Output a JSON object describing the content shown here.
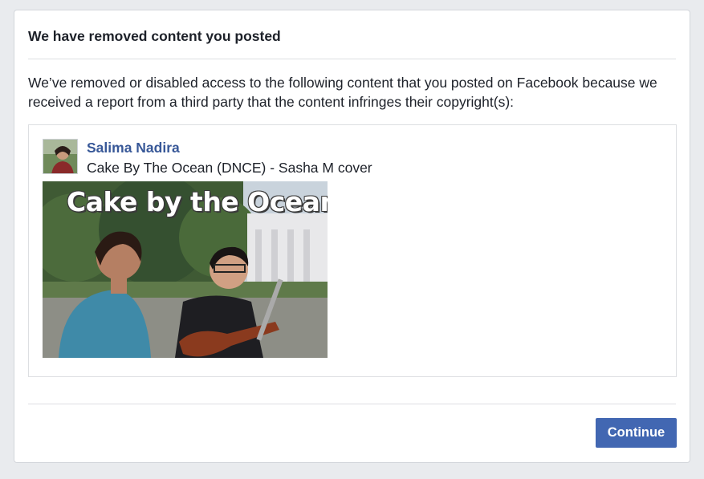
{
  "dialog": {
    "title": "We have removed content you posted",
    "message": "We’ve removed or disabled access to the following content that you posted on Facebook because we received a report from a third party that the content infringes their copyright(s):"
  },
  "post": {
    "author": "Salima Nadira",
    "title": "Cake By The Ocean (DNCE) - Sasha M cover",
    "thumbnail_caption": "Cake by the Ocean"
  },
  "actions": {
    "continue_label": "Continue"
  },
  "colors": {
    "accent": "#4267b2",
    "link": "#385898",
    "background": "#e9ebee"
  }
}
